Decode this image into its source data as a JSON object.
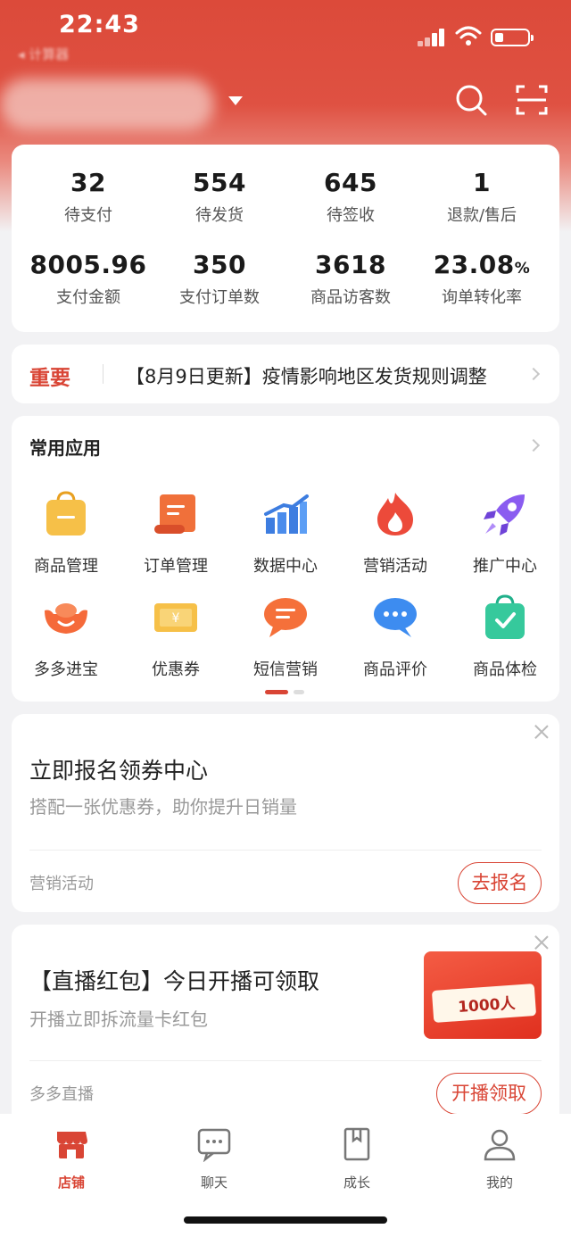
{
  "status_bar": {
    "time": "22:43",
    "back_app": "◂ 计算器"
  },
  "stats": [
    {
      "value": "32",
      "unit": "",
      "label": "待支付"
    },
    {
      "value": "554",
      "unit": "",
      "label": "待发货"
    },
    {
      "value": "645",
      "unit": "",
      "label": "待签收"
    },
    {
      "value": "1",
      "unit": "",
      "label": "退款/售后"
    },
    {
      "value": "8005.96",
      "unit": "",
      "label": "支付金额"
    },
    {
      "value": "350",
      "unit": "",
      "label": "支付订单数"
    },
    {
      "value": "3618",
      "unit": "",
      "label": "商品访客数"
    },
    {
      "value": "23.08",
      "unit": "%",
      "label": "询单转化率"
    }
  ],
  "notice": {
    "tag": "重要",
    "text": "【8月9日更新】疫情影响地区发货规则调整"
  },
  "apps": {
    "title": "常用应用",
    "items": [
      {
        "label": "商品管理",
        "icon": "shopping-bag-icon"
      },
      {
        "label": "订单管理",
        "icon": "scroll-icon"
      },
      {
        "label": "数据中心",
        "icon": "bar-chart-icon"
      },
      {
        "label": "营销活动",
        "icon": "flame-icon"
      },
      {
        "label": "推广中心",
        "icon": "rocket-icon"
      },
      {
        "label": "多多进宝",
        "icon": "gold-ingot-icon"
      },
      {
        "label": "优惠券",
        "icon": "coupon-icon"
      },
      {
        "label": "短信营销",
        "icon": "message-icon"
      },
      {
        "label": "商品评价",
        "icon": "comment-icon"
      },
      {
        "label": "商品体检",
        "icon": "check-bag-icon"
      }
    ]
  },
  "promo1": {
    "title": "立即报名领券中心",
    "subtitle": "搭配一张优惠券，助你提升日销量",
    "tag": "营销活动",
    "button": "去报名"
  },
  "promo2": {
    "title": "【直播红包】今日开播可领取",
    "subtitle": "开播立即拆流量卡红包",
    "tag": "多多直播",
    "button": "开播领取",
    "image_text": "1000人"
  },
  "tabs": [
    {
      "label": "店铺",
      "icon": "store-icon",
      "active": true
    },
    {
      "label": "聊天",
      "icon": "chat-icon",
      "active": false
    },
    {
      "label": "成长",
      "icon": "book-icon",
      "active": false
    },
    {
      "label": "我的",
      "icon": "person-icon",
      "active": false
    }
  ],
  "colors": {
    "brand": "#d94535",
    "header": "#dc4a3a",
    "background": "#f2f2f4"
  }
}
